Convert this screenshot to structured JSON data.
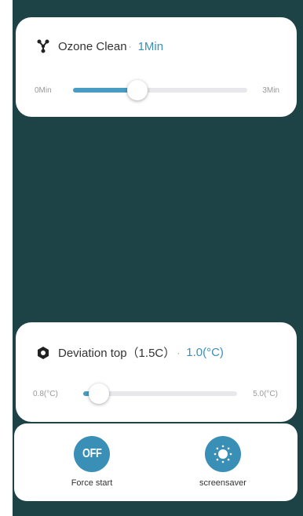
{
  "ozone": {
    "icon": "molecule-icon",
    "title": "Ozone Clean",
    "separator": "·",
    "value": "1Min",
    "slider": {
      "min_label": "0Min",
      "max_label": "3Min",
      "min": 0,
      "max": 3,
      "value": 1,
      "fraction": 0.37
    }
  },
  "deviation": {
    "icon": "hexagon-icon",
    "title": "Deviation top（1.5C）",
    "separator": "·",
    "value": "1.0(°C)",
    "slider": {
      "min_label": "0.8(°C)",
      "max_label": "5.0(°C)",
      "min": 0.8,
      "max": 5.0,
      "value": 1.0,
      "fraction": 0.1
    }
  },
  "actions": {
    "force_start": {
      "icon_text": "OFF",
      "label": "Force start",
      "icon": "off-icon"
    },
    "screensaver": {
      "label": "screensaver",
      "icon": "sun-icon"
    }
  },
  "colors": {
    "background": "#1e4347",
    "accent": "#3a8fb7",
    "track": "#e8e8ec",
    "card": "#ffffff"
  }
}
